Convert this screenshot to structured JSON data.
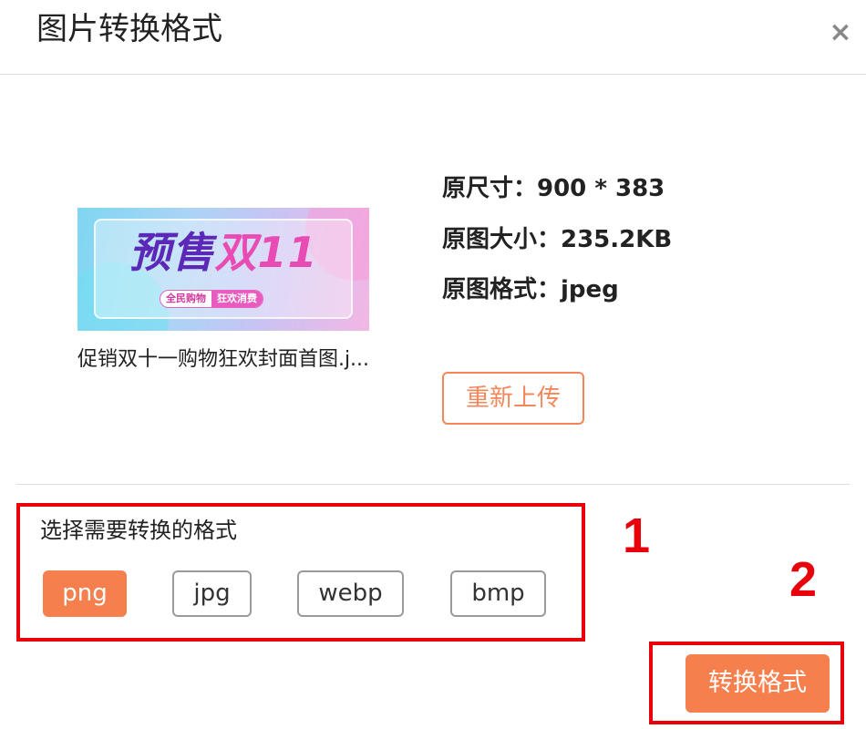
{
  "dialog": {
    "title": "图片转换格式",
    "close_symbol": "×"
  },
  "preview": {
    "image_headline_part1": "预售",
    "image_headline_part2": "双11",
    "image_tag_left": "全民购物",
    "image_tag_right": "狂欢消费",
    "filename": "促销双十一购物狂欢封面首图.j..."
  },
  "info": {
    "size_line": "原尺寸：900 * 383",
    "filesize_line": "原图大小：235.2KB",
    "format_line": "原图格式：jpeg"
  },
  "reupload_label": "重新上传",
  "format_select": {
    "label": "选择需要转换的格式",
    "options": [
      "png",
      "jpg",
      "webp",
      "bmp"
    ],
    "selected": "png"
  },
  "annotations": {
    "marker_1": "1",
    "marker_2": "2"
  },
  "convert_label": "转换格式",
  "colors": {
    "accent": "#f5804d",
    "annotation_red": "#e8000b"
  }
}
